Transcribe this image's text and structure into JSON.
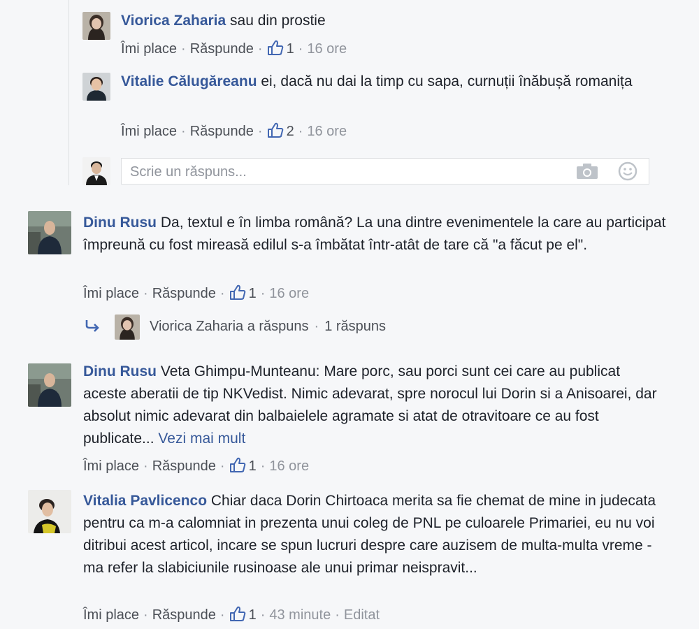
{
  "comments": [
    {
      "author": "Viorica Zaharia",
      "text": "sau din prostie",
      "like_label": "Îmi place",
      "reply_label": "Răspunde",
      "likes": "1",
      "time": "16 ore"
    },
    {
      "author": "Vitalie Călugăreanu",
      "text": "ei, dacă nu dai la timp cu sapa, curnuții înăbușă romanița",
      "like_label": "Îmi place",
      "reply_label": "Răspunde",
      "likes": "2",
      "time": "16 ore"
    },
    {
      "author": "Dinu Rusu",
      "text": "Da, textul e în limba română? La una dintre evenimentele la care au participat împreună cu fost mireasă edilul s-a îmbătat într-atât de tare că \"a făcut pe el\".",
      "like_label": "Îmi place",
      "reply_label": "Răspunde",
      "likes": "1",
      "time": "16 ore"
    },
    {
      "author": "Dinu Rusu",
      "text": "Veta Ghimpu-Munteanu: Mare porc, sau porci sunt cei care au publicat aceste aberatii de tip NKVedist. Nimic adevarat, spre norocul lui Dorin si a Anisoarei, dar absolut nimic adevarat din balbaielele agramate si atat de otravitoare ce au fost publicate...",
      "see_more": "Vezi mai mult",
      "like_label": "Îmi place",
      "reply_label": "Răspunde",
      "likes": "1",
      "time": "16 ore"
    },
    {
      "author": "Vitalia Pavlicenco",
      "text": "Chiar daca Dorin Chirtoaca merita sa fie chemat de mine in judecata pentru ca m-a calomniat in prezenta unui coleg de PNL pe culoarele Primariei, eu nu voi ditribui acest articol, incare se spun lucruri despre care auzisem de multa-multa vreme - ma refer la slabiciunile rusinoase ale unui primar neispravit...",
      "like_label": "Îmi place",
      "reply_label": "Răspunde",
      "likes": "1",
      "time": "43 minute",
      "edited": "Editat"
    }
  ],
  "reply_box": {
    "placeholder": "Scrie un răspuns..."
  },
  "replies_summary": {
    "text": "Viorica Zaharia a răspuns",
    "count": "1 răspuns"
  },
  "colors": {
    "author": "#365899",
    "meta": "#90949c",
    "background": "#f6f7f9"
  }
}
